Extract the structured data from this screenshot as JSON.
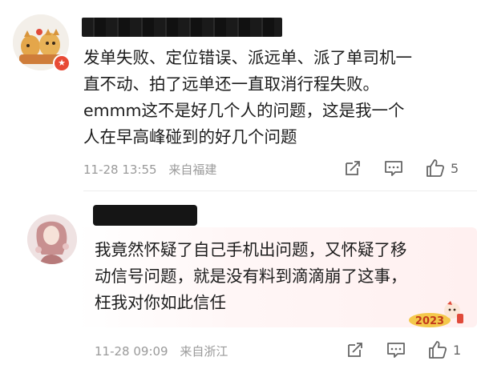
{
  "comments": [
    {
      "content_lines": [
        "发单失败、定位错误、派远单、派了单司机一",
        "直不动、拍了远单还一直取消行程失败。",
        "emmm这不是好几个人的问题，这是我一个",
        "人在早高峰碰到的好几个问题"
      ],
      "time": "11-28 13:55",
      "location": "来自福建",
      "likes": "5",
      "badge_icon": "star-badge-icon"
    },
    {
      "content_lines": [
        "我竟然怀疑了自己手机出问题，又怀疑了移",
        "动信号问题，就是没有料到滴滴崩了这事，",
        "枉我对你如此信任"
      ],
      "time": "11-28 09:09",
      "location": "来自浙江",
      "likes": "1",
      "sticker_text": "2023"
    }
  ],
  "colors": {
    "text": "#1c1c1c",
    "meta": "#9a9a9a",
    "badge": "#e84a35"
  }
}
